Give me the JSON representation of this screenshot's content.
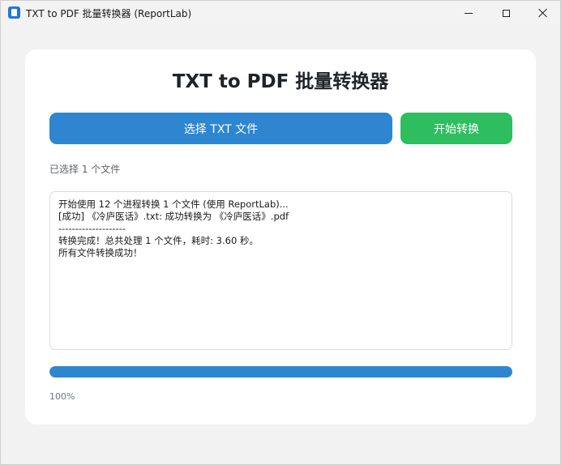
{
  "window": {
    "title": "TXT to PDF 批量转换器 (ReportLab)"
  },
  "main": {
    "heading": "TXT to PDF 批量转换器",
    "select_button_label": "选择 TXT 文件",
    "start_button_label": "开始转换",
    "file_count_text": "已选择 1 个文件",
    "log_lines": [
      "开始使用 12 个进程转换 1 个文件 (使用 ReportLab)...",
      "[成功] 《冷庐医话》.txt: 成功转换为 《冷庐医话》.pdf",
      "--------------------",
      "转换完成！总共处理 1 个文件，耗时: 3.60 秒。",
      "所有文件转换成功！"
    ],
    "progress_fraction": 1.0,
    "progress_text": "100%"
  },
  "colors": {
    "primary": "#2d86cf",
    "success": "#2ebd5f"
  },
  "icons": {
    "app": "app-icon",
    "minimize": "minimize-icon",
    "maximize": "maximize-icon",
    "close": "close-icon"
  }
}
